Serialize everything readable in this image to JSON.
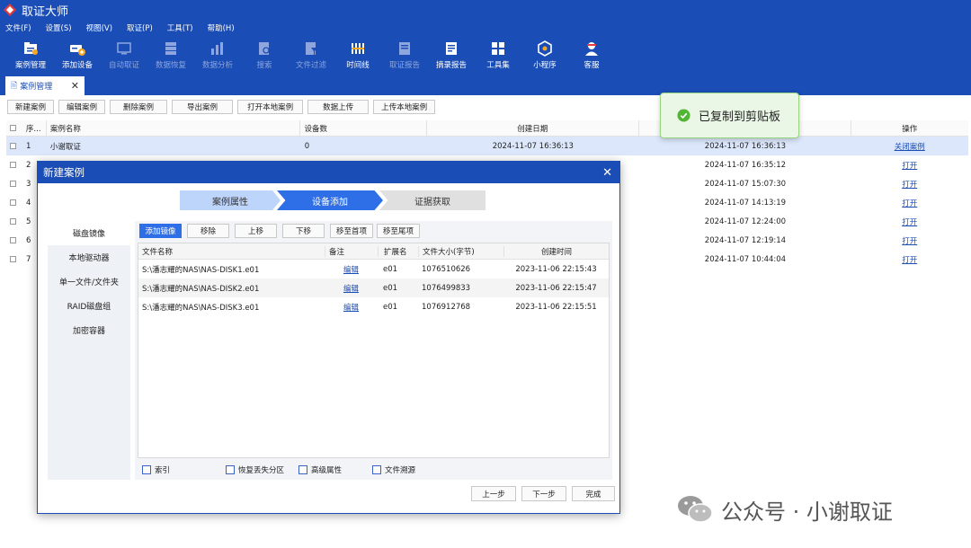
{
  "app": {
    "title": "取证大师"
  },
  "menu": [
    "文件(F)",
    "设置(S)",
    "视图(V)",
    "取证(P)",
    "工具(T)",
    "帮助(H)"
  ],
  "toolbar": [
    {
      "label": "案例管理",
      "icon": "case-folder-icon",
      "enabled": true
    },
    {
      "label": "添加设备",
      "icon": "add-device-icon",
      "enabled": true
    },
    {
      "label": "自动取证",
      "icon": "monitor-icon",
      "enabled": false
    },
    {
      "label": "数据恢复",
      "icon": "recover-icon",
      "enabled": false
    },
    {
      "label": "数据分析",
      "icon": "analysis-icon",
      "enabled": false
    },
    {
      "label": "搜索",
      "icon": "search-doc-icon",
      "enabled": false
    },
    {
      "label": "文件过滤",
      "icon": "filter-doc-icon",
      "enabled": false
    },
    {
      "label": "时间线",
      "icon": "timeline-icon",
      "enabled": true
    },
    {
      "label": "取证报告",
      "icon": "report-icon",
      "enabled": false
    },
    {
      "label": "摘录报告",
      "icon": "excerpt-icon",
      "enabled": true
    },
    {
      "label": "工具集",
      "icon": "tools-grid-icon",
      "enabled": true
    },
    {
      "label": "小程序",
      "icon": "miniapp-icon",
      "enabled": true
    },
    {
      "label": "客服",
      "icon": "support-icon",
      "enabled": true
    }
  ],
  "tab": {
    "label": "案例管理",
    "close": "✕"
  },
  "actions": [
    "新建案例",
    "编辑案例",
    "删除案例",
    "导出案例",
    "打开本地案例",
    "数据上传",
    "上传本地案例"
  ],
  "case_table": {
    "headers": {
      "no": "序...",
      "name": "案例名称",
      "count": "设备数",
      "date": "创建日期",
      "op": "操作"
    },
    "rows": [
      {
        "no": "1",
        "name": "小谢取证",
        "count": "0",
        "date": "2024-11-07 16:36:13",
        "modified": "2024-11-07 16:36:13",
        "op": "关闭案例",
        "selected": true
      },
      {
        "no": "2",
        "name": "",
        "count": "",
        "date": "",
        "modified": "2024-11-07 16:35:12",
        "op": "打开",
        "selected": false
      },
      {
        "no": "3",
        "name": "",
        "count": "",
        "date": "",
        "modified": "2024-11-07 15:07:30",
        "op": "打开",
        "selected": false
      },
      {
        "no": "4",
        "name": "",
        "count": "",
        "date": "",
        "modified": "2024-11-07 14:13:19",
        "op": "打开",
        "selected": false
      },
      {
        "no": "5",
        "name": "",
        "count": "",
        "date": "",
        "modified": "2024-11-07 12:24:00",
        "op": "打开",
        "selected": false
      },
      {
        "no": "6",
        "name": "",
        "count": "",
        "date": "",
        "modified": "2024-11-07 12:19:14",
        "op": "打开",
        "selected": false
      },
      {
        "no": "7",
        "name": "",
        "count": "",
        "date": "",
        "modified": "2024-11-07 10:44:04",
        "op": "打开",
        "selected": false
      }
    ]
  },
  "toast": {
    "text": "已复制到剪贴板"
  },
  "dialog": {
    "title": "新建案例",
    "close": "✕",
    "steps": [
      "案例属性",
      "设备添加",
      "证据获取"
    ],
    "active_step": 1,
    "sidebar": [
      "磁盘镜像",
      "本地驱动器",
      "单一文件/文件夹",
      "RAID磁盘组",
      "加密容器"
    ],
    "panel_buttons": [
      "添加镜像",
      "移除",
      "上移",
      "下移",
      "移至首项",
      "移至尾项"
    ],
    "file_table": {
      "headers": {
        "name": "文件名称",
        "note": "备注",
        "ext": "扩展名",
        "size": "文件大小(字节)",
        "time": "创建时间"
      },
      "rows": [
        {
          "name": "S:\\潘志耀的NAS\\NAS-DISK1.e01",
          "note": "编辑",
          "ext": "e01",
          "size": "1076510626",
          "time": "2023-11-06 22:15:43"
        },
        {
          "name": "S:\\潘志耀的NAS\\NAS-DISK2.e01",
          "note": "编辑",
          "ext": "e01",
          "size": "1076499833",
          "time": "2023-11-06 22:15:47"
        },
        {
          "name": "S:\\潘志耀的NAS\\NAS-DISK3.e01",
          "note": "编辑",
          "ext": "e01",
          "size": "1076912768",
          "time": "2023-11-06 22:15:51"
        }
      ]
    },
    "options": [
      "索引",
      "恢复丢失分区",
      "高级属性",
      "文件溯源"
    ],
    "footer_buttons": [
      "上一步",
      "下一步",
      "完成"
    ]
  },
  "watermark": "公众号 · 小谢取证"
}
